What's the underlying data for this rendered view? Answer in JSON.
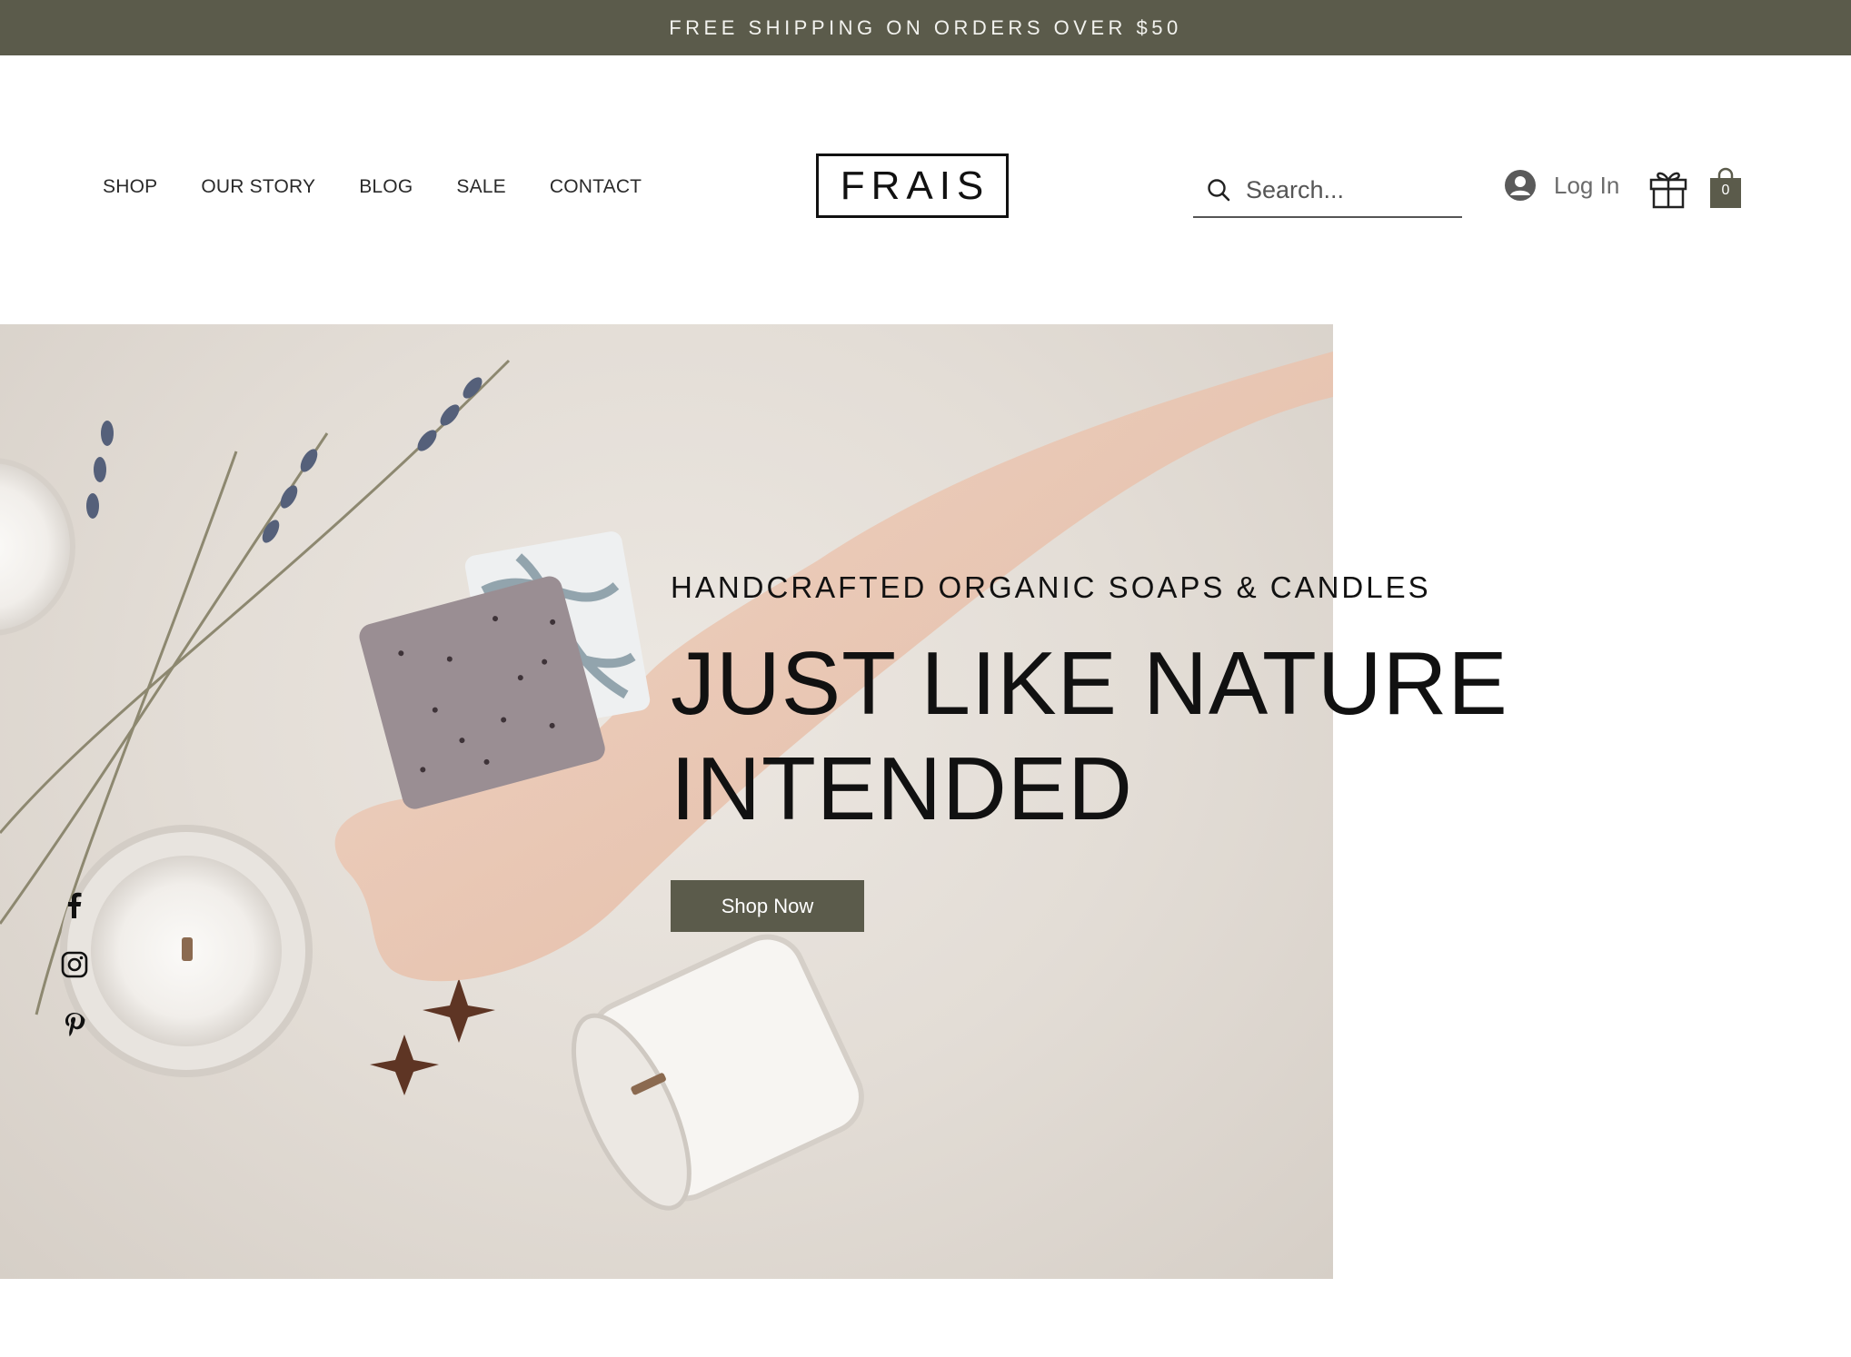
{
  "announcement": {
    "text": "FREE SHIPPING ON ORDERS OVER $50"
  },
  "nav": {
    "items": [
      "SHOP",
      "OUR STORY",
      "BLOG",
      "SALE",
      "CONTACT"
    ]
  },
  "logo": {
    "text": "FRAIS"
  },
  "search": {
    "placeholder": "Search..."
  },
  "account": {
    "login_label": "Log In"
  },
  "cart": {
    "count": "0"
  },
  "hero": {
    "subtitle": "HANDCRAFTED ORGANIC SOAPS & CANDLES",
    "title_line1": "JUST LIKE NATURE",
    "title_line2": "INTENDED",
    "cta_label": "Shop Now"
  },
  "social": {
    "icons": [
      "facebook-icon",
      "instagram-icon",
      "pinterest-icon"
    ]
  },
  "colors": {
    "brand": "#5b5b4b",
    "text": "#111111",
    "background": "#ffffff"
  }
}
